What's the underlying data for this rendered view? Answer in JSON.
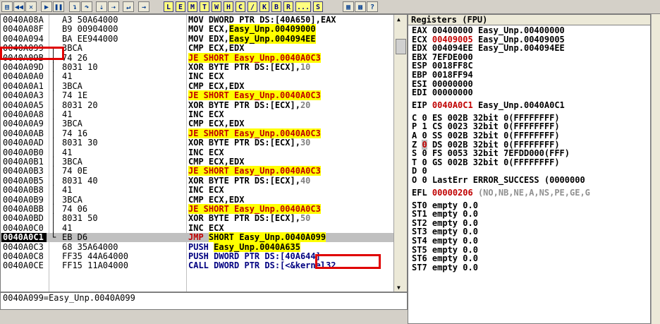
{
  "toolbar": {
    "letters": [
      "L",
      "E",
      "M",
      "T",
      "W",
      "H",
      "C",
      "/",
      "K",
      "B",
      "R",
      "...",
      "S"
    ]
  },
  "cpu": {
    "rows": [
      {
        "addr": "0040A08A",
        "arrow": "",
        "hex": "A3 50A64000",
        "dis": [
          {
            "t": "MOV DWORD PTR DS:[40A650],EAX",
            "c": ""
          }
        ]
      },
      {
        "addr": "0040A08F",
        "arrow": "",
        "hex": "B9 00904000",
        "dis": [
          {
            "t": "MOV ECX,",
            "c": ""
          },
          {
            "t": "Easy_Unp.00409000",
            "c": "hl"
          }
        ]
      },
      {
        "addr": "0040A094",
        "arrow": "",
        "hex": "BA EE944000",
        "dis": [
          {
            "t": "MOV EDX,",
            "c": ""
          },
          {
            "t": "Easy_Unp.004094EE",
            "c": "hl"
          }
        ]
      },
      {
        "addr": "0040A099",
        "arrow": "┌",
        "hex": "3BCA",
        "dis": [
          {
            "t": "CMP ECX,EDX",
            "c": ""
          }
        ]
      },
      {
        "addr": "0040A09B",
        "arrow": "│",
        "hex": "74 26",
        "dis": [
          {
            "t": "JE SHORT Easy_Unp.0040A0C3",
            "c": "jmp"
          }
        ]
      },
      {
        "addr": "0040A09D",
        "arrow": "│",
        "hex": "8031 10",
        "dis": [
          {
            "t": "XOR BYTE PTR DS:[ECX],",
            "c": ""
          },
          {
            "t": "10",
            "c": "cmt"
          }
        ]
      },
      {
        "addr": "0040A0A0",
        "arrow": "│",
        "hex": "41",
        "dis": [
          {
            "t": "INC ECX",
            "c": ""
          }
        ]
      },
      {
        "addr": "0040A0A1",
        "arrow": "│",
        "hex": "3BCA",
        "dis": [
          {
            "t": "CMP ECX,EDX",
            "c": ""
          }
        ]
      },
      {
        "addr": "0040A0A3",
        "arrow": "│",
        "hex": "74 1E",
        "dis": [
          {
            "t": "JE SHORT Easy_Unp.0040A0C3",
            "c": "jmp"
          }
        ]
      },
      {
        "addr": "0040A0A5",
        "arrow": "│",
        "hex": "8031 20",
        "dis": [
          {
            "t": "XOR BYTE PTR DS:[ECX],",
            "c": ""
          },
          {
            "t": "20",
            "c": "cmt"
          }
        ]
      },
      {
        "addr": "0040A0A8",
        "arrow": "│",
        "hex": "41",
        "dis": [
          {
            "t": "INC ECX",
            "c": ""
          }
        ]
      },
      {
        "addr": "0040A0A9",
        "arrow": "│",
        "hex": "3BCA",
        "dis": [
          {
            "t": "CMP ECX,EDX",
            "c": ""
          }
        ]
      },
      {
        "addr": "0040A0AB",
        "arrow": "│",
        "hex": "74 16",
        "dis": [
          {
            "t": "JE SHORT Easy_Unp.0040A0C3",
            "c": "jmp"
          }
        ]
      },
      {
        "addr": "0040A0AD",
        "arrow": "│",
        "hex": "8031 30",
        "dis": [
          {
            "t": "XOR BYTE PTR DS:[ECX],",
            "c": ""
          },
          {
            "t": "30",
            "c": "cmt"
          }
        ]
      },
      {
        "addr": "0040A0B0",
        "arrow": "│",
        "hex": "41",
        "dis": [
          {
            "t": "INC ECX",
            "c": ""
          }
        ]
      },
      {
        "addr": "0040A0B1",
        "arrow": "│",
        "hex": "3BCA",
        "dis": [
          {
            "t": "CMP ECX,EDX",
            "c": ""
          }
        ]
      },
      {
        "addr": "0040A0B3",
        "arrow": "│",
        "hex": "74 0E",
        "dis": [
          {
            "t": "JE SHORT Easy_Unp.0040A0C3",
            "c": "jmp"
          }
        ]
      },
      {
        "addr": "0040A0B5",
        "arrow": "│",
        "hex": "8031 40",
        "dis": [
          {
            "t": "XOR BYTE PTR DS:[ECX],",
            "c": ""
          },
          {
            "t": "40",
            "c": "cmt"
          }
        ]
      },
      {
        "addr": "0040A0B8",
        "arrow": "│",
        "hex": "41",
        "dis": [
          {
            "t": "INC ECX",
            "c": ""
          }
        ]
      },
      {
        "addr": "0040A0B9",
        "arrow": "│",
        "hex": "3BCA",
        "dis": [
          {
            "t": "CMP ECX,EDX",
            "c": ""
          }
        ]
      },
      {
        "addr": "0040A0BB",
        "arrow": "│",
        "hex": "74 06",
        "dis": [
          {
            "t": "JE SHORT Easy_Unp.0040A0C3",
            "c": "jmp"
          }
        ]
      },
      {
        "addr": "0040A0BD",
        "arrow": "│",
        "hex": "8031 50",
        "dis": [
          {
            "t": "XOR BYTE PTR DS:[ECX],",
            "c": ""
          },
          {
            "t": "50",
            "c": "cmt"
          }
        ]
      },
      {
        "addr": "0040A0C0",
        "arrow": "│",
        "hex": "41",
        "dis": [
          {
            "t": "INC ECX",
            "c": ""
          }
        ]
      },
      {
        "addr": "0040A0C1",
        "arrow": "└",
        "hex": "EB D6",
        "dis": [
          {
            "t": "JMP ",
            "c": "jmpk"
          },
          {
            "t": "SHORT Easy_Unp.",
            "c": "hl"
          },
          {
            "t": "0040A099",
            "c": "hl"
          }
        ],
        "selected": true
      },
      {
        "addr": "0040A0C3",
        "arrow": "",
        "hex": "68 35A64000",
        "dis": [
          {
            "t": "PUSH ",
            "c": "push"
          },
          {
            "t": "Easy_Unp.0040A635",
            "c": "hl"
          }
        ]
      },
      {
        "addr": "0040A0C8",
        "arrow": "",
        "hex": "FF35 44A64000",
        "dis": [
          {
            "t": "PUSH DWORD PTR DS:[40A644]",
            "c": "push"
          }
        ]
      },
      {
        "addr": "0040A0CE",
        "arrow": "",
        "hex": "FF15 11A04000",
        "dis": [
          {
            "t": "CALL DWORD PTR DS:[<&kernel32",
            "c": "push"
          }
        ]
      }
    ],
    "info_text": "0040A099=Easy_Unp.0040A099"
  },
  "registers": {
    "title": "Registers (FPU)",
    "gp": [
      {
        "name": "EAX",
        "value": "00400000",
        "comment": "Easy_Unp.00400000",
        "changed": false
      },
      {
        "name": "ECX",
        "value": "00409005",
        "comment": "Easy_Unp.00409005",
        "changed": true
      },
      {
        "name": "EDX",
        "value": "004094EE",
        "comment": "Easy_Unp.004094EE",
        "changed": false
      },
      {
        "name": "EBX",
        "value": "7EFDE000",
        "comment": "",
        "changed": false
      },
      {
        "name": "ESP",
        "value": "0018FF8C",
        "comment": "",
        "changed": false
      },
      {
        "name": "EBP",
        "value": "0018FF94",
        "comment": "",
        "changed": false
      },
      {
        "name": "ESI",
        "value": "00000000",
        "comment": "",
        "changed": false
      },
      {
        "name": "EDI",
        "value": "00000000",
        "comment": "",
        "changed": false
      }
    ],
    "eip": {
      "name": "EIP",
      "value": "0040A0C1",
      "comment": "Easy_Unp.0040A0C1"
    },
    "flags": [
      {
        "f": "C",
        "v": "0",
        "seg": "ES 002B 32bit 0(FFFFFFFF)"
      },
      {
        "f": "P",
        "v": "1",
        "seg": "CS 0023 32bit 0(FFFFFFFF)"
      },
      {
        "f": "A",
        "v": "0",
        "seg": "SS 002B 32bit 0(FFFFFFFF)"
      },
      {
        "f": "Z",
        "v": "0",
        "seg": "DS 002B 32bit 0(FFFFFFFF)"
      },
      {
        "f": "S",
        "v": "0",
        "seg": "FS 0053 32bit 7EFDD000(FFF)"
      },
      {
        "f": "T",
        "v": "0",
        "seg": "GS 002B 32bit 0(FFFFFFFF)"
      },
      {
        "f": "D",
        "v": "0",
        "seg": ""
      },
      {
        "f": "O",
        "v": "0",
        "seg": "LastErr ERROR_SUCCESS (0000000"
      }
    ],
    "efl": {
      "name": "EFL",
      "value": "00000206",
      "text": "(NO,NB,NE,A,NS,PE,GE,G"
    },
    "st": [
      "ST0 empty 0.0",
      "ST1 empty 0.0",
      "ST2 empty 0.0",
      "ST3 empty 0.0",
      "ST4 empty 0.0",
      "ST5 empty 0.0",
      "ST6 empty 0.0",
      "ST7 empty 0.0"
    ]
  },
  "colors": {
    "highlight": "#ffff00",
    "changed": "#c00000",
    "annotation": "#e00000"
  }
}
